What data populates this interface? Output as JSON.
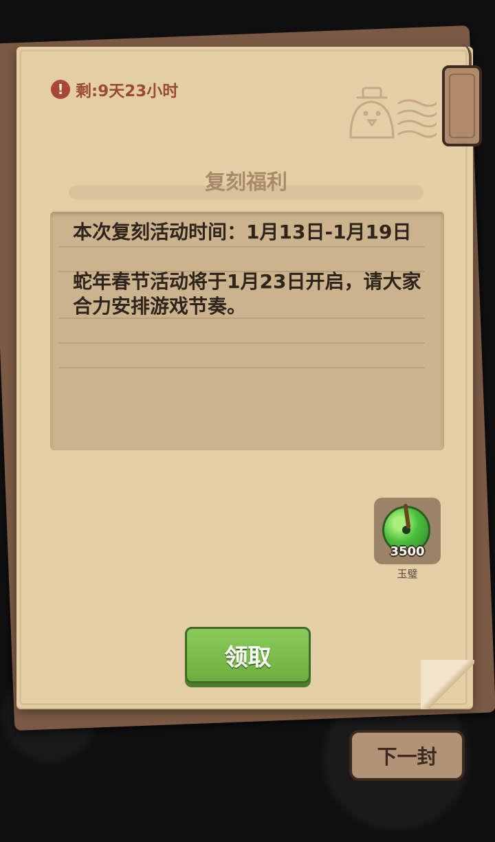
{
  "timer": {
    "icon": "alert-icon",
    "text": "剩:9天23小时"
  },
  "letter": {
    "title": "复刻福利",
    "content": "本次复刻活动时间：1月13日-1月19日\n\n蛇年春节活动将于1月23日开启，请大家合力安排游戏节奏。"
  },
  "reward": {
    "icon": "jade-disc-icon",
    "count": "3500",
    "name": "玉璧"
  },
  "buttons": {
    "claim_label": "领取",
    "next_label": "下一封"
  },
  "colors": {
    "paper": "#e3cea6",
    "claim_green": "#7bbd4d",
    "timer_red": "#9b4a33"
  }
}
